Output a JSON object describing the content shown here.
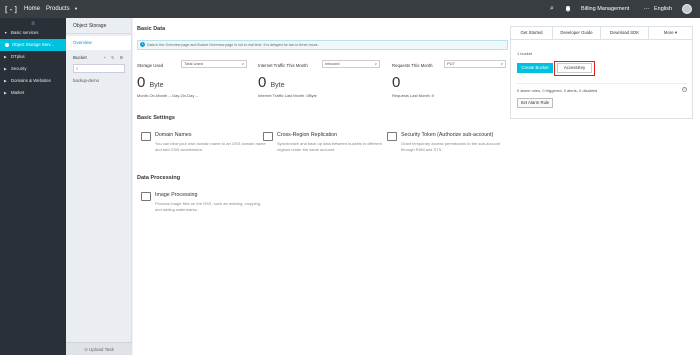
{
  "topbar": {
    "logo": "[-]",
    "home": "Home",
    "products": "Products",
    "billing": "Billing Management",
    "more": "...",
    "language": "English"
  },
  "leftnav": {
    "collapse": "|||",
    "items": [
      {
        "label": "Basic services"
      },
      {
        "label": "Object Storage Serv..."
      },
      {
        "label": "DTplus"
      },
      {
        "label": "Security"
      },
      {
        "label": "Domains & Websites"
      },
      {
        "label": "Market"
      }
    ]
  },
  "sidebar": {
    "title": "Object Storage",
    "overview": "Overview",
    "bucket": "Bucket",
    "bucket_icons": "+ ↻ ⊞",
    "buckets": [
      "backup-demo"
    ],
    "upload": "Upload Task"
  },
  "main": {
    "basic_data_title": "Basic Data",
    "info_text": "Data in the Overview page and Bucket Overview page is not in real time. It is delayed for two to three hours.",
    "stats": [
      {
        "label": "Storage Used",
        "select": "Total Used",
        "value": "0",
        "unit": "Byte",
        "foot": "Month-On-Month --  Day-On-Day --"
      },
      {
        "label": "Internet Traffic This Month",
        "select": "Inbound",
        "value": "0",
        "unit": "Byte",
        "foot": "Internet Traffic Last Month :0Byte"
      },
      {
        "label": "Requests This Month",
        "select": "PUT",
        "value": "0",
        "unit": "",
        "foot": "Requests Last Month :0"
      }
    ],
    "basic_settings_title": "Basic Settings",
    "settings": [
      {
        "title": "Domain Names",
        "desc": "You can bind your own domain name to an OSS domain name and add CDN acceleration."
      },
      {
        "title": "Cross-Region Replication",
        "desc": "Synchronize and back up data between buckets in different regions under the same account."
      },
      {
        "title": "Security Token (Authorize sub-account)",
        "desc": "Grant temporary access permissions to the sub-account through RAM and STS."
      }
    ],
    "data_processing_title": "Data Processing",
    "processing": [
      {
        "title": "Image Processing",
        "desc": "Process image files on the OSS, such as resizing, cropping, and adding watermarks."
      }
    ]
  },
  "rpanel": {
    "tabs": [
      "Get Started",
      "Developer Guide",
      "Download SDK",
      "More"
    ],
    "bucket_count": "1 bucket",
    "create_bucket": "Create Bucket",
    "accesskey": "AccessKey",
    "alarm_text": "0 alarm rules, 0 triggered, 0 alerts, 0 disabled",
    "help": "?",
    "set_alarm": "Set Alarm Rule"
  },
  "colors": {
    "accent": "#00c1de",
    "topbar": "#373d41",
    "leftnav": "#293038",
    "highlight": "#e02020"
  }
}
